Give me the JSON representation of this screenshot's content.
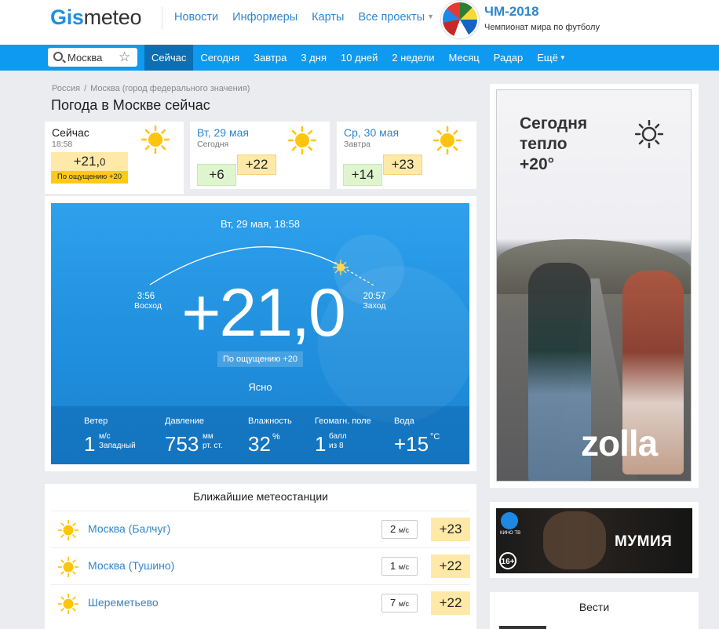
{
  "header": {
    "logo_part1": "Gis",
    "logo_part2": "meteo",
    "nav": [
      "Новости",
      "Информеры",
      "Карты",
      "Все проекты"
    ],
    "wc_title": "ЧМ-2018",
    "wc_subtitle": "Чемпионат мира по футболу"
  },
  "search": {
    "value": "Москва"
  },
  "tabs": [
    "Сейчас",
    "Сегодня",
    "Завтра",
    "3 дня",
    "10 дней",
    "2 недели",
    "Месяц",
    "Радар",
    "Ещё"
  ],
  "breadcrumb": [
    "Россия",
    "Москва (город федерального значения)"
  ],
  "page_title": "Погода в Москве сейчас",
  "now_card": {
    "title": "Сейчас",
    "time": "18:58",
    "temp_int": "+21,",
    "temp_dec": "0",
    "feels": "По ощущению +20"
  },
  "day_cards": [
    {
      "title": "Вт, 29 мая",
      "sub": "Сегодня",
      "min": "+6",
      "max": "+22"
    },
    {
      "title": "Ср, 30 мая",
      "sub": "Завтра",
      "min": "+14",
      "max": "+23"
    }
  ],
  "main": {
    "date": "Вт, 29 мая, 18:58",
    "sunrise_time": "3:56",
    "sunrise_label": "Восход",
    "sunset_time": "20:57",
    "sunset_label": "Заход",
    "temp": "+21,0",
    "feels": "По ощущению +20",
    "condition": "Ясно"
  },
  "stats": {
    "wind": {
      "label": "Ветер",
      "value": "1",
      "unit1": "м/с",
      "unit2": "Западный"
    },
    "pressure": {
      "label": "Давление",
      "value": "753",
      "unit1": "мм",
      "unit2": "рт. ст."
    },
    "humidity": {
      "label": "Влажность",
      "value": "32",
      "unit": "%"
    },
    "geomag": {
      "label": "Геомагн. поле",
      "value": "1",
      "unit1": "балл",
      "unit2": "из 8"
    },
    "water": {
      "label": "Вода",
      "value": "+15",
      "unit": "°C"
    }
  },
  "stations": {
    "header": "Ближайшие метеостанции",
    "wind_unit": "м/с",
    "rows": [
      {
        "name": "Москва (Балчуг)",
        "wind": "2",
        "temp": "+23"
      },
      {
        "name": "Москва (Тушино)",
        "wind": "1",
        "temp": "+22"
      },
      {
        "name": "Шереметьево",
        "wind": "7",
        "temp": "+22"
      }
    ]
  },
  "ads": {
    "zolla_line1": "Сегодня",
    "zolla_line2": "тепло",
    "zolla_line3": "+20°",
    "zolla_brand": "zolla",
    "kino_badge": "КИНО ТВ",
    "age": "16+",
    "movie": "МУМИЯ",
    "news_title": "Вести"
  },
  "colors": {
    "accent": "#0e9af0",
    "link": "#2f86cf",
    "warm": "#ffe9a8",
    "cool": "#dff5cf",
    "sun": "#ffc50d"
  }
}
